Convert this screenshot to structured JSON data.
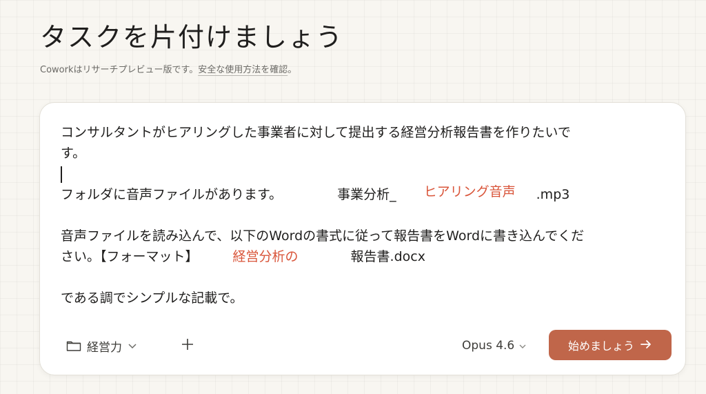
{
  "header": {
    "title": "タスクを片付けましょう",
    "subtitle_prefix": "Coworkはリサーチプレビュー版です。",
    "subtitle_link": "安全な使用方法を確認",
    "subtitle_suffix": "。"
  },
  "prompt": {
    "line1": "コンサルタントがヒアリングした事業者に対して提出する経営分析報告書を作りたいで",
    "line2": "す。",
    "line3_a": "フォルダに音声ファイルがあります。",
    "line3_b": "事業分析_",
    "line3_tag": "ヒアリング音声",
    "line3_c": ".mp3",
    "line4": "音声ファイルを読み込んで、以下のWordの書式に従って報告書をWordに書き込んでくだ",
    "line5_a": "さい。【フォーマット】",
    "line5_tag": "経営分析の",
    "line5_b": "報告書.docx",
    "line6": "である調でシンプルな記載で。"
  },
  "toolbar": {
    "folder_label": "経営力",
    "folder_icon": "folder-icon",
    "add_icon": "plus-icon",
    "model_label": "Opus 4.6",
    "start_label": "始めましょう",
    "start_icon": "arrow-right-icon"
  },
  "colors": {
    "accent": "#c0664a",
    "annotation": "#d9553a",
    "background": "#f8f6f1"
  }
}
